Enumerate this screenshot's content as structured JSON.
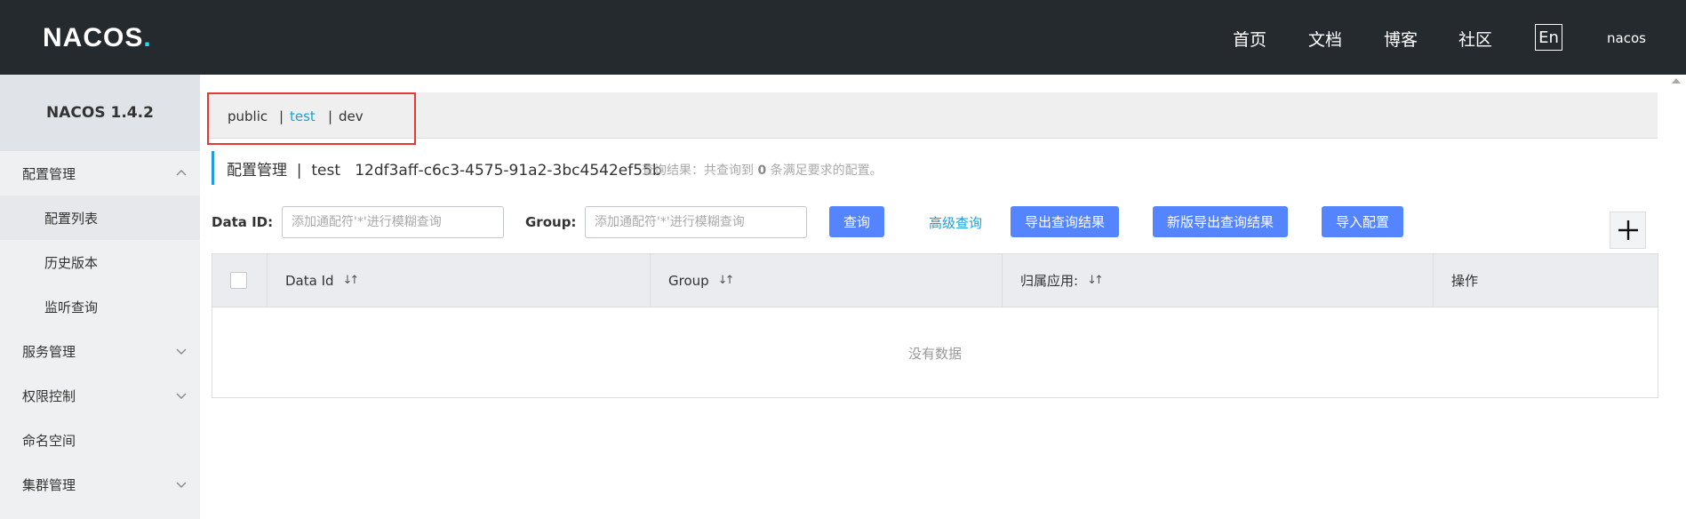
{
  "header": {
    "logo_text": "NACOS",
    "nav": [
      "首页",
      "文档",
      "博客",
      "社区"
    ],
    "lang_button": "En",
    "user": "nacos"
  },
  "sidebar": {
    "version": "NACOS 1.4.2",
    "groups": [
      {
        "label": "配置管理",
        "expanded": true,
        "items": [
          "配置列表",
          "历史版本",
          "监听查询"
        ]
      },
      {
        "label": "服务管理",
        "expanded": false
      },
      {
        "label": "权限控制",
        "expanded": false
      },
      {
        "label": "命名空间"
      },
      {
        "label": "集群管理",
        "expanded": false
      }
    ],
    "active_item": "配置列表"
  },
  "namespaces": {
    "items": [
      "public",
      "test",
      "dev"
    ],
    "separator": "|",
    "active": "test"
  },
  "page": {
    "title": "配置管理  |  test   12df3aff-c6c3-4575-91a2-3bc4542ef55b",
    "result_prefix": "查询结果：共查询到",
    "result_count": "0",
    "result_suffix": "条满足要求的配置。"
  },
  "search": {
    "data_id_label": "Data ID:",
    "data_id_placeholder": "添加通配符'*'进行模糊查询",
    "group_label": "Group:",
    "group_placeholder": "添加通配符'*'进行模糊查询",
    "query_button": "查询",
    "advanced_link": "高级查询",
    "export_button": "导出查询结果",
    "export_new_button": "新版导出查询结果",
    "import_button": "导入配置"
  },
  "table": {
    "columns": [
      "Data Id",
      "Group",
      "归属应用:",
      "操作"
    ],
    "empty_text": "没有数据"
  },
  "colors": {
    "topbar": "#252a2f",
    "primary_button": "#5584ff",
    "link": "#1aa0dc",
    "highlight_box": "#e53935"
  }
}
